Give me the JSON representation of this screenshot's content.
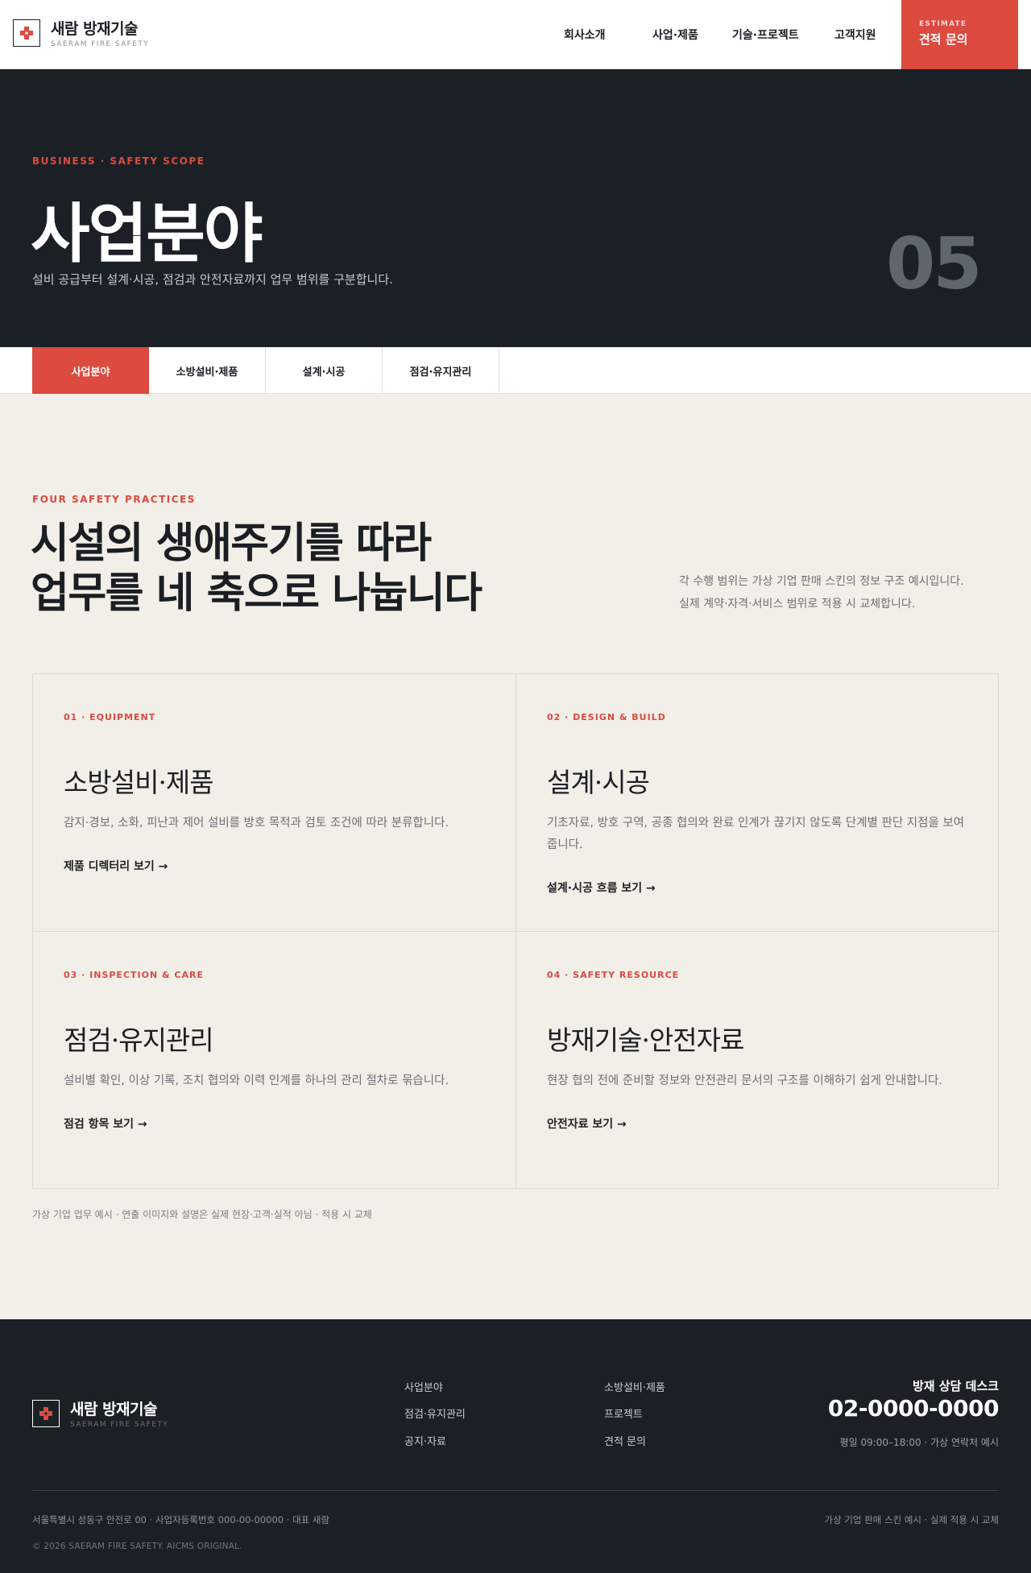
{
  "header": {
    "logo_title": "새람 방재기술",
    "logo_sub": "SAERAM FIRE SAFETY",
    "nav": [
      "회사소개",
      "사업·제품",
      "기술·프로젝트",
      "고객지원"
    ],
    "cta_sub": "ESTIMATE",
    "cta_label": "견적 문의"
  },
  "hero": {
    "eyebrow": "BUSINESS · SAFETY SCOPE",
    "title": "사업분야",
    "description": "설비 공급부터 설계·시공, 점검과 안전자료까지 업무 범위를 구분합니다.",
    "number": "05"
  },
  "tabs": [
    "사업분야",
    "소방설비·제품",
    "설계·시공",
    "점검·유지관리"
  ],
  "section": {
    "eyebrow": "FOUR SAFETY PRACTICES",
    "title_line1": "시설의 생애주기를 따라",
    "title_line2": "업무를 네 축으로 나눕니다",
    "desc_line1": "각 수행 범위는 가상 기업 판매 스킨의 정보 구조 예시입니다.",
    "desc_line2": "실제 계약·자격·서비스 범위로 적용 시 교체합니다."
  },
  "cards": [
    {
      "eyebrow": "01 · EQUIPMENT",
      "title": "소방설비·제품",
      "description": "감지·경보, 소화, 피난과 제어 설비를 방호 목적과 검토 조건에 따라 분류합니다.",
      "link": "제품 디렉터리 보기 →"
    },
    {
      "eyebrow": "02 · DESIGN & BUILD",
      "title": "설계·시공",
      "description": "기초자료, 방호 구역, 공종 협의와 완료 인계가 끊기지 않도록 단계별 판단 지점을 보여 줍니다.",
      "link": "설계·시공 흐름 보기 →"
    },
    {
      "eyebrow": "03 · INSPECTION & CARE",
      "title": "점검·유지관리",
      "description": "설비별 확인, 이상 기록, 조치 협의와 이력 인계를 하나의 관리 절차로 묶습니다.",
      "link": "점검 항목 보기 →"
    },
    {
      "eyebrow": "04 · SAFETY RESOURCE",
      "title": "방재기술·안전자료",
      "description": "현장 협의 전에 준비할 정보와 안전관리 문서의 구조를 이해하기 쉽게 안내합니다.",
      "link": "안전자료 보기 →"
    }
  ],
  "note": "가상 기업 업무 예시 · 연출 이미지와 설명은 실제 현장·고객·실적 아님 · 적용 시 교체",
  "footer": {
    "logo_title": "새람 방재기술",
    "logo_sub": "SAERAM FIRE SAFETY",
    "links_col1": [
      "사업분야",
      "점검·유지관리",
      "공지·자료"
    ],
    "links_col2": [
      "소방설비·제품",
      "프로젝트",
      "견적 문의"
    ],
    "desk_title": "방재 상담 데스크",
    "phone": "02-0000-0000",
    "hours": "평일 09:00–18:00 · 가상 연락처 예시",
    "address": "서울특별시 성동구 안전로 00 · 사업자등록번호 000-00-00000 · 대표 새람",
    "right_note": "가상 기업 판매 스킨 예시 · 실제 적용 시 교체",
    "copyright": "© 2026 SAERAM FIRE SAFETY. AICMS ORIGINAL."
  },
  "colors": {
    "accent": "#dc4a40",
    "dark": "#1b2026",
    "background": "#f2efe8"
  }
}
